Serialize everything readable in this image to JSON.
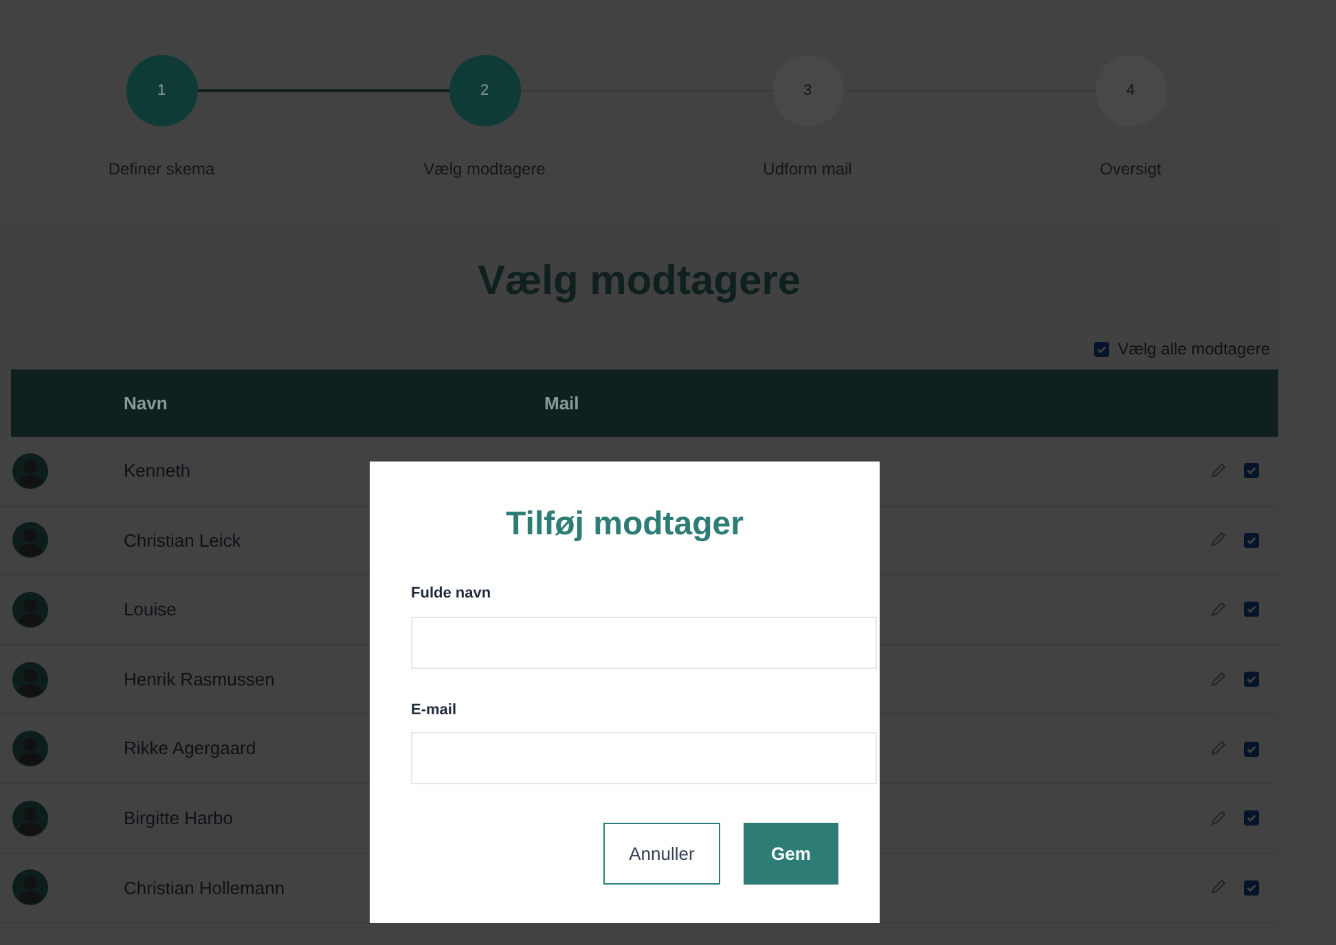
{
  "steps": [
    {
      "number": "1",
      "label": "Definer skema",
      "completed": true
    },
    {
      "number": "2",
      "label": "Vælg modtagere",
      "completed": true
    },
    {
      "number": "3",
      "label": "Udform mail",
      "completed": false
    },
    {
      "number": "4",
      "label": "Oversigt",
      "completed": false
    }
  ],
  "title": "Vælg modtagere",
  "select_all": {
    "label": "Vælg alle modtagere",
    "checked": true
  },
  "table": {
    "columns": [
      "Navn",
      "Mail"
    ],
    "rows": [
      {
        "name": "Kenneth",
        "checked": true
      },
      {
        "name": "Christian Leick",
        "checked": true
      },
      {
        "name": "Louise",
        "checked": true
      },
      {
        "name": "Henrik Rasmussen",
        "checked": true
      },
      {
        "name": "Rikke Agergaard",
        "checked": true
      },
      {
        "name": "Birgitte Harbo",
        "checked": true
      },
      {
        "name": "Christian Hollemann",
        "checked": true
      }
    ]
  },
  "dialog": {
    "title": "Tilføj modtager",
    "fields": [
      {
        "label": "Fulde navn"
      },
      {
        "label": "E-mail"
      }
    ],
    "buttons": [
      {
        "label": "Annuller",
        "kind": "secondary"
      },
      {
        "label": "Gem",
        "kind": "primary"
      }
    ]
  }
}
